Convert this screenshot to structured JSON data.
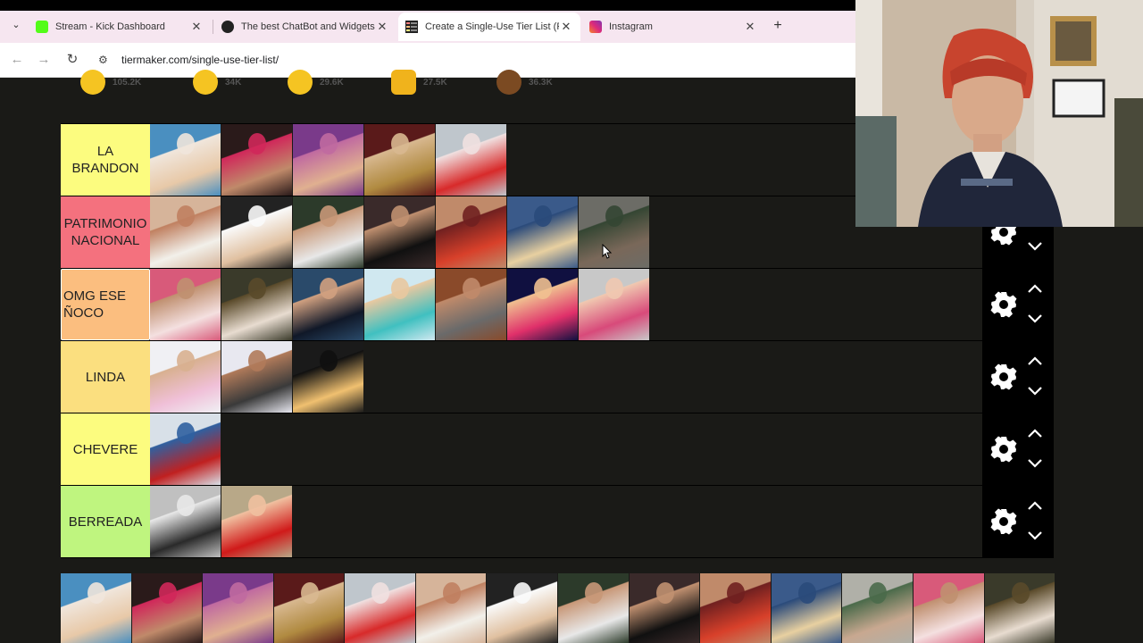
{
  "browser": {
    "tabs": [
      {
        "title": "Stream - Kick Dashboard",
        "favicon": "kick-icon",
        "color": "#53fc18",
        "active": false
      },
      {
        "title": "The best ChatBot and Widgets",
        "favicon": "chatbot-icon",
        "color": "#222222",
        "active": false
      },
      {
        "title": "Create a Single-Use Tier List (P",
        "favicon": "tiermaker-icon",
        "color": "#1b1b1b",
        "active": true
      },
      {
        "title": "Instagram",
        "favicon": "instagram-icon",
        "color": "#d6249f",
        "active": false
      }
    ],
    "new_tab_symbol": "+",
    "close_symbol": "✕",
    "dropdown_symbol": "⌄",
    "url": "tiermaker.com/single-use-tier-list/",
    "nav": {
      "back": "←",
      "forward": "→",
      "reload": "↻",
      "site_info": "⚙"
    }
  },
  "reactions": [
    {
      "icon": "laughing-face-icon",
      "count": "105.2K"
    },
    {
      "icon": "grinning-face-icon",
      "count": "34K"
    },
    {
      "icon": "grinning-squint-icon",
      "count": "29.6K"
    },
    {
      "icon": "raised-hands-icon",
      "count": "27.5K"
    },
    {
      "icon": "poop-icon",
      "count": "36.3K"
    }
  ],
  "tiers": [
    {
      "label": "LA BRANDON",
      "color": "#fcfc7f",
      "items": 5,
      "selected": false
    },
    {
      "label": "PATRIMONIO NACIONAL",
      "color": "#f4717e",
      "items": 7,
      "selected": false
    },
    {
      "label": "OMG ESE ÑOCO",
      "color": "#fbbe7f",
      "items": 7,
      "selected": true
    },
    {
      "label": "LINDA",
      "color": "#fbdf7f",
      "items": 3,
      "selected": false
    },
    {
      "label": "CHEVERE",
      "color": "#fcfc7f",
      "items": 1,
      "selected": false
    },
    {
      "label": "BERREADA",
      "color": "#bff57f",
      "items": 2,
      "selected": false
    }
  ],
  "pool_count": 14,
  "colors": {
    "background": "#1a1a17",
    "control_bg": "#000000",
    "tab_strip": "#f6e6f0"
  }
}
